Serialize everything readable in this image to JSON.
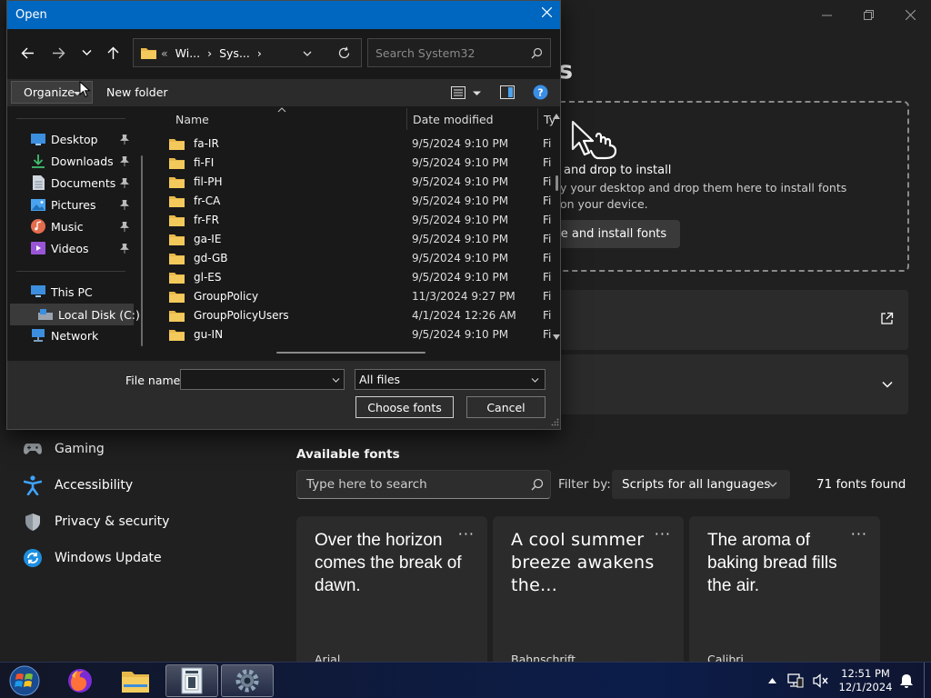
{
  "settings": {
    "title_fragment": "s",
    "drop_title": "and drop to install",
    "drop_desc_line1": "y your desktop and drop them here to install fonts",
    "drop_desc_line2": "on your device.",
    "browse_label": "se and install fonts",
    "nav_items": [
      {
        "label": "Gaming",
        "icon": "gamepad-icon"
      },
      {
        "label": "Accessibility",
        "icon": "accessibility-icon"
      },
      {
        "label": "Privacy & security",
        "icon": "shield-icon"
      },
      {
        "label": "Windows Update",
        "icon": "update-icon"
      }
    ],
    "available_label": "Available fonts",
    "search_placeholder": "Type here to search",
    "filter_label": "Filter by:",
    "filter_value": "Scripts for all languages",
    "fonts_count": "71 fonts found",
    "font_cards": [
      {
        "preview": "Over the horizon comes the break of dawn.",
        "font_name": "Arial"
      },
      {
        "preview": "A cool summer breeze awakens the...",
        "font_name": "Bahnschrift"
      },
      {
        "preview": "The aroma of baking bread fills the air.",
        "font_name": "Calibri"
      }
    ]
  },
  "dialog": {
    "title": "Open",
    "address": {
      "overflow": "«",
      "crumbs": [
        "Wi...",
        "›",
        "Sys...",
        "›"
      ]
    },
    "search_placeholder": "Search System32",
    "organize_label": "Organize",
    "new_folder_label": "New folder",
    "nav_pane": {
      "quick_access": [
        {
          "label": "Desktop",
          "icon": "desktop-icon",
          "color": "#3c8ede"
        },
        {
          "label": "Downloads",
          "icon": "download-icon",
          "color": "#3fbf6f"
        },
        {
          "label": "Documents",
          "icon": "document-icon",
          "color": "#cfd6df"
        },
        {
          "label": "Pictures",
          "icon": "pictures-icon",
          "color": "#4aa3ef"
        },
        {
          "label": "Music",
          "icon": "music-icon",
          "color": "#e36d4e"
        },
        {
          "label": "Videos",
          "icon": "videos-icon",
          "color": "#9a55d6"
        }
      ],
      "this_pc": "This PC",
      "local_disk": "Local Disk (C:)",
      "network": "Network"
    },
    "columns": {
      "name": "Name",
      "date": "Date modified",
      "type": "Ty"
    },
    "files": [
      {
        "name": "fa-IR",
        "date": "9/5/2024 9:10 PM",
        "type": "Fi"
      },
      {
        "name": "fi-FI",
        "date": "9/5/2024 9:10 PM",
        "type": "Fi"
      },
      {
        "name": "fil-PH",
        "date": "9/5/2024 9:10 PM",
        "type": "Fi"
      },
      {
        "name": "fr-CA",
        "date": "9/5/2024 9:10 PM",
        "type": "Fi"
      },
      {
        "name": "fr-FR",
        "date": "9/5/2024 9:10 PM",
        "type": "Fi"
      },
      {
        "name": "ga-IE",
        "date": "9/5/2024 9:10 PM",
        "type": "Fi"
      },
      {
        "name": "gd-GB",
        "date": "9/5/2024 9:10 PM",
        "type": "Fi"
      },
      {
        "name": "gl-ES",
        "date": "9/5/2024 9:10 PM",
        "type": "Fi"
      },
      {
        "name": "GroupPolicy",
        "date": "11/3/2024 9:27 PM",
        "type": "Fi"
      },
      {
        "name": "GroupPolicyUsers",
        "date": "4/1/2024 12:26 AM",
        "type": "Fi"
      },
      {
        "name": "gu-IN",
        "date": "9/5/2024 9:10 PM",
        "type": "Fi"
      }
    ],
    "file_name_label": "File name:",
    "file_name_value": "",
    "file_type_value": "All files",
    "choose_label": "Choose fonts",
    "cancel_label": "Cancel"
  },
  "taskbar": {
    "time": "12:51 PM",
    "date": "12/1/2024"
  },
  "colors": {
    "accent": "#0067c0",
    "folder": "#e8b84a",
    "help": "#3a8ee6"
  }
}
